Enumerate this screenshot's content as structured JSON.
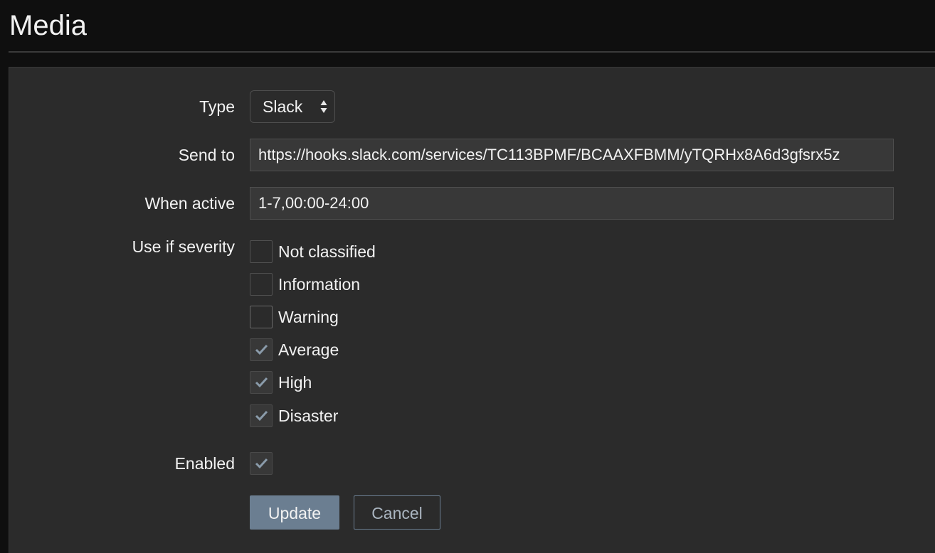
{
  "page": {
    "title": "Media"
  },
  "form": {
    "type": {
      "label": "Type",
      "value": "Slack"
    },
    "send_to": {
      "label": "Send to",
      "value": "https://hooks.slack.com/services/TC113BPMF/BCAAXFBMM/yTQRHx8A6d3gfsrx5z"
    },
    "when_active": {
      "label": "When active",
      "value": "1-7,00:00-24:00"
    },
    "severity": {
      "label": "Use if severity",
      "options": [
        {
          "label": "Not classified",
          "checked": false
        },
        {
          "label": "Information",
          "checked": false
        },
        {
          "label": "Warning",
          "checked": false
        },
        {
          "label": "Average",
          "checked": true
        },
        {
          "label": "High",
          "checked": true
        },
        {
          "label": "Disaster",
          "checked": true
        }
      ]
    },
    "enabled": {
      "label": "Enabled",
      "checked": true
    },
    "buttons": {
      "update": "Update",
      "cancel": "Cancel"
    }
  },
  "colors": {
    "background": "#0f0f0f",
    "panel": "#2b2b2b",
    "input": "#383838",
    "primary_button": "#6b7e91",
    "check_mark": "#8a9baa"
  },
  "icons": {
    "select_arrows": "sort-arrows-icon",
    "check": "check-icon"
  }
}
